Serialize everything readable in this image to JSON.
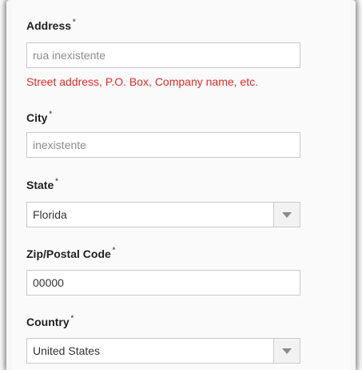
{
  "address": {
    "label": "Address",
    "required_mark": "*",
    "value": "rua inexistente",
    "hint": "Street address, P.O. Box, Company name, etc."
  },
  "city": {
    "label": "City",
    "required_mark": "*",
    "value": "inexistente"
  },
  "state": {
    "label": "State",
    "required_mark": "*",
    "selected": "Florida"
  },
  "zip": {
    "label": "Zip/Postal Code",
    "required_mark": "*",
    "value": "00000"
  },
  "country": {
    "label": "Country",
    "required_mark": "*",
    "selected": "United States"
  },
  "colors": {
    "hint_error": "#e02b27",
    "border": "#c9c9c9",
    "label": "#1f1f1f"
  },
  "icons": {
    "select_toggle": "chevron-down-icon"
  }
}
